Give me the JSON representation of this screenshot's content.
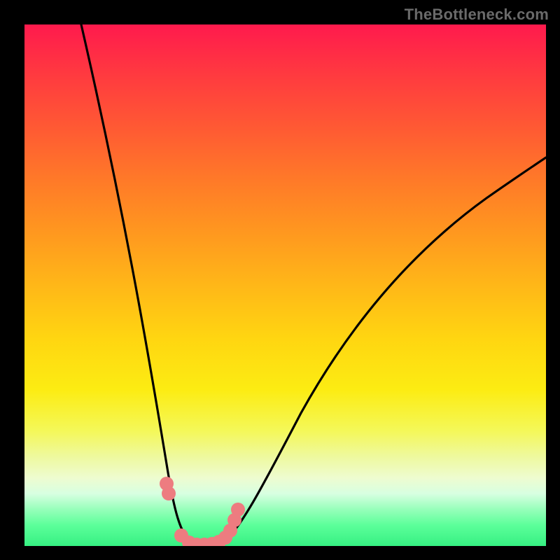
{
  "watermark": "TheBottleneck.com",
  "chart_data": {
    "type": "line",
    "title": "",
    "xlabel": "",
    "ylabel": "",
    "xlim": [
      0,
      100
    ],
    "ylim": [
      0,
      100
    ],
    "series": [
      {
        "name": "curve-left",
        "x": [
          10.9,
          12,
          14,
          16,
          18,
          20,
          22,
          23.5,
          25,
          26,
          27,
          27.8,
          28.5,
          29.2,
          29.8,
          30.5,
          31.2,
          32
        ],
        "values": [
          100,
          93,
          84,
          75,
          65,
          55,
          44,
          35,
          26,
          19,
          13,
          8,
          5,
          3,
          1.5,
          0.8,
          0.4,
          0.2
        ]
      },
      {
        "name": "curve-right",
        "x": [
          38,
          40,
          42,
          45,
          48,
          52,
          56,
          60,
          65,
          70,
          75,
          80,
          85,
          90,
          95,
          100
        ],
        "values": [
          0.2,
          1.5,
          4,
          9,
          15,
          22,
          29,
          36,
          44,
          50,
          56,
          61,
          65.5,
          69.5,
          73,
          76
        ]
      },
      {
        "name": "marker-points",
        "x": [
          27.2,
          27.6,
          30.0,
          31.5,
          33.0,
          34.5,
          36.0,
          37.3,
          38.5,
          39.5,
          40.3,
          41.0
        ],
        "values": [
          12.0,
          10.0,
          2.0,
          0.6,
          0.3,
          0.3,
          0.4,
          0.8,
          1.6,
          3.0,
          5.0,
          7.0
        ]
      }
    ],
    "marker_color": "#ed7c80",
    "curve_color": "#000000"
  }
}
